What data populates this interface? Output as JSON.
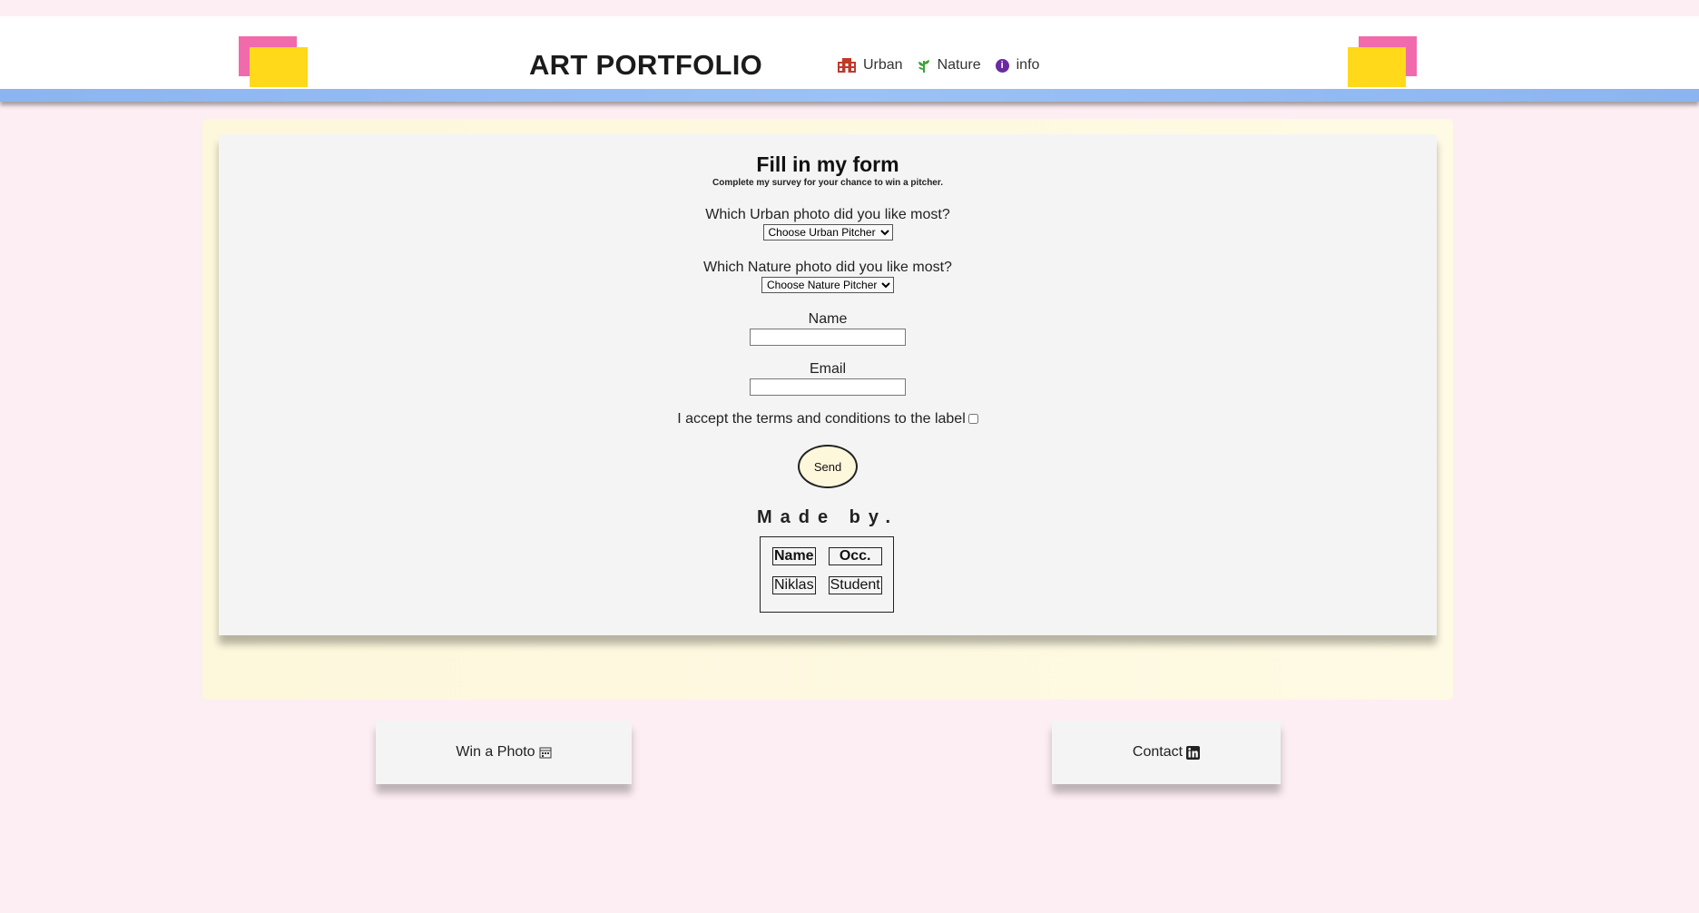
{
  "header": {
    "title": "ART PORTFOLIO",
    "nav": [
      {
        "label": "Urban",
        "icon": "building-icon"
      },
      {
        "label": "Nature",
        "icon": "plant-icon"
      },
      {
        "label": "info",
        "icon": "info-icon"
      }
    ]
  },
  "form": {
    "title": "Fill in my form",
    "subtitle": "Complete my survey for your chance to win a pitcher.",
    "urban_question": "Which Urban photo did you like most?",
    "urban_select": "Choose Urban Pitcher",
    "nature_question": "Which Nature photo did you like most?",
    "nature_select": "Choose Nature Pitcher",
    "name_label": "Name",
    "name_value": "",
    "email_label": "Email",
    "email_value": "",
    "terms_label": "I accept the terms and conditions to the label",
    "terms_checked": false,
    "send_label": "Send"
  },
  "credits": {
    "heading": "Made by.",
    "headers": [
      "Name",
      "Occ."
    ],
    "rows": [
      [
        "Niklas",
        "Student"
      ]
    ]
  },
  "footer": {
    "win_label": "Win a Photo",
    "contact_label": "Contact"
  },
  "colors": {
    "background": "#fdeef4",
    "accent_pink": "#f06aac",
    "accent_yellow": "#ffd91a",
    "header_bar": "#8cb4f0",
    "panel": "#fdf7dc",
    "card": "#f4f4f4"
  }
}
